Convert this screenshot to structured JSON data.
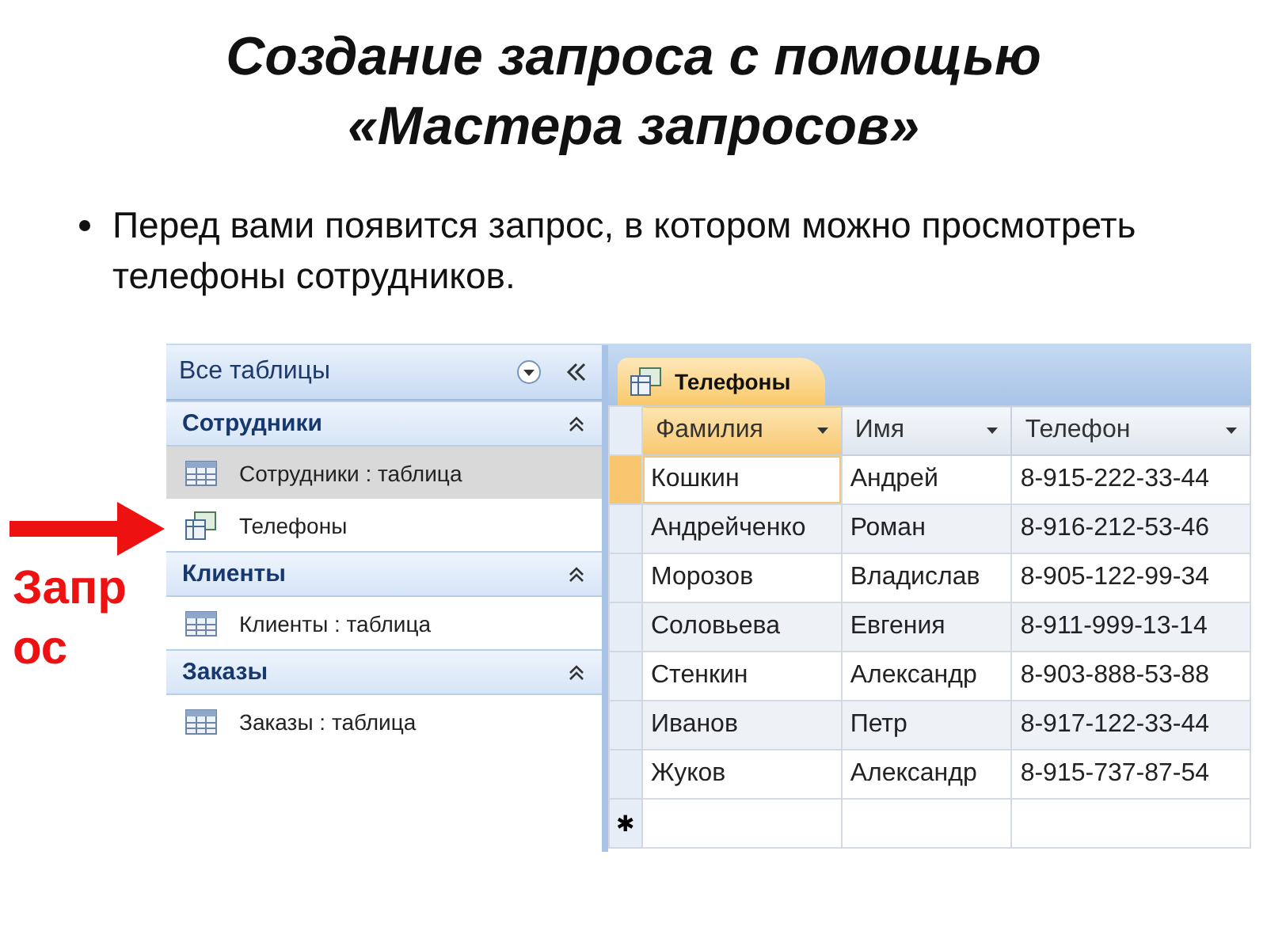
{
  "slide": {
    "title": "Создание запроса с помощью «Мастера запросов»",
    "bullets": [
      "Перед вами появится запрос, в котором можно просмотреть телефоны сотрудников."
    ],
    "callout": "Запрос"
  },
  "nav_pane": {
    "title": "Все таблицы",
    "groups": [
      {
        "name": "Сотрудники",
        "expanded": true,
        "items": [
          {
            "kind": "table",
            "label": "Сотрудники : таблица",
            "selected": true
          },
          {
            "kind": "query",
            "label": "Телефоны",
            "selected": false
          }
        ]
      },
      {
        "name": "Клиенты",
        "expanded": true,
        "items": [
          {
            "kind": "table",
            "label": "Клиенты : таблица",
            "selected": false
          }
        ]
      },
      {
        "name": "Заказы",
        "expanded": true,
        "items": [
          {
            "kind": "table",
            "label": "Заказы : таблица",
            "selected": false
          }
        ]
      }
    ]
  },
  "tabs": [
    {
      "label": "Телефоны",
      "selected": true
    }
  ],
  "table": {
    "columns": [
      {
        "label": "Фамилия",
        "selected": true
      },
      {
        "label": "Имя",
        "selected": false
      },
      {
        "label": "Телефон",
        "selected": false
      }
    ],
    "rows": [
      {
        "cells": [
          "Кошкин",
          "Андрей",
          "8-915-222-33-44"
        ],
        "selected": true
      },
      {
        "cells": [
          "Андрейченко",
          "Роман",
          "8-916-212-53-46"
        ],
        "selected": false
      },
      {
        "cells": [
          "Морозов",
          "Владислав",
          "8-905-122-99-34"
        ],
        "selected": false
      },
      {
        "cells": [
          "Соловьева",
          "Евгения",
          "8-911-999-13-14"
        ],
        "selected": false
      },
      {
        "cells": [
          "Стенкин",
          "Александр",
          "8-903-888-53-88"
        ],
        "selected": false
      },
      {
        "cells": [
          "Иванов",
          "Петр",
          "8-917-122-33-44"
        ],
        "selected": false
      },
      {
        "cells": [
          "Жуков",
          "Александр",
          "8-915-737-87-54"
        ],
        "selected": false
      }
    ],
    "new_row_marker": "✱"
  }
}
